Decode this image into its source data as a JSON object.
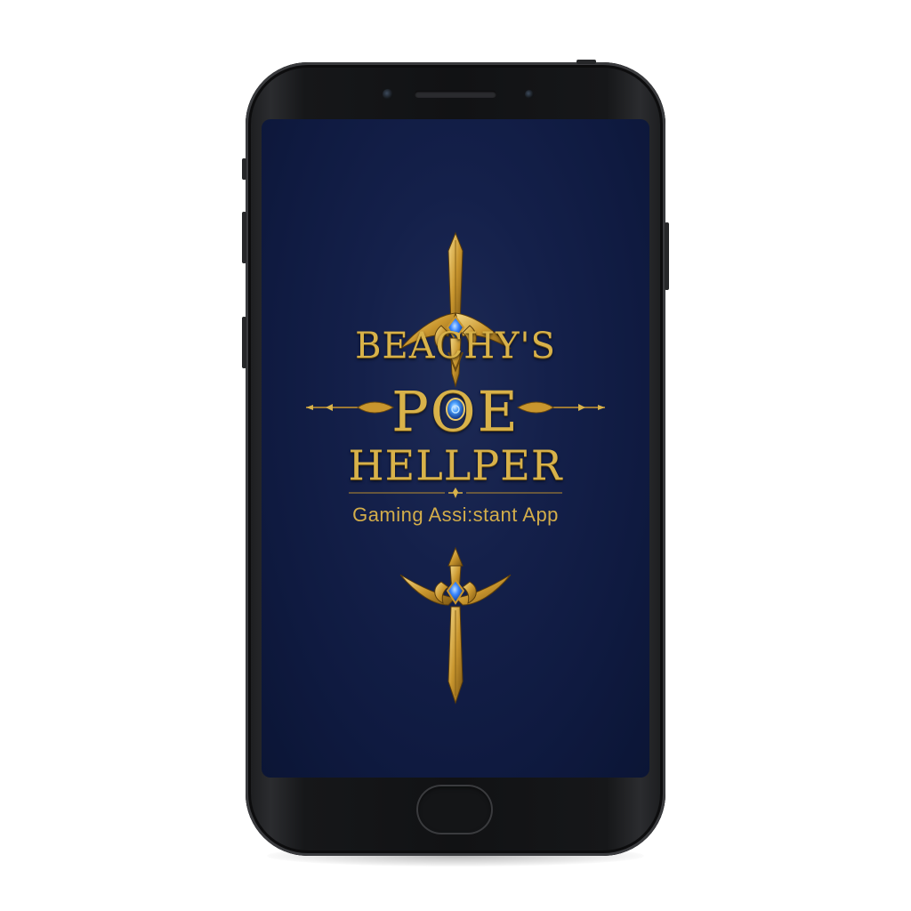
{
  "app": {
    "title_line_1": "BEACHY'S",
    "title_line_2": "POE",
    "title_line_3": "HELLPER",
    "subtitle": "Gaming Assi:stant App"
  },
  "colors": {
    "gold": "#d8b24a",
    "screen_bg": "#14204a",
    "gem_blue": "#2a6cff",
    "phone_body": "#111214"
  },
  "icons": {
    "top_emblem": "sword-emblem-icon",
    "bottom_emblem": "sword-emblem-icon",
    "center_gem": "blue-gem-icon",
    "left_ornament": "spear-ornament-icon",
    "right_ornament": "spear-ornament-icon"
  }
}
